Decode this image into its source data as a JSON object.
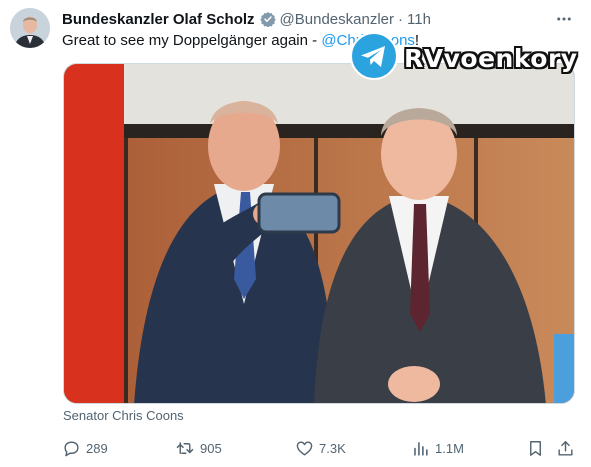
{
  "tweet": {
    "author_name": "Bundeskanzler Olaf Scholz",
    "handle": "@Bundeskanzler",
    "separator": "·",
    "time": "11h",
    "text_before": "Great to see my Doppelgänger again - ",
    "mention": "@ChrisCoons",
    "text_after": "!",
    "media_caption": "Senator Chris Coons",
    "verified_color": "#829aab",
    "accent_color": "#1d9bf0"
  },
  "watermark": {
    "text": "RVvoenkory",
    "icon": "telegram-icon"
  },
  "actions": {
    "replies": "289",
    "reposts": "905",
    "likes": "7.3K",
    "views": "1.1M",
    "icons": [
      "reply-icon",
      "repost-icon",
      "like-icon",
      "views-icon",
      "bookmark-icon",
      "share-icon"
    ]
  },
  "colors": {
    "secondary_text": "#536471",
    "primary_text": "#0f1419"
  }
}
